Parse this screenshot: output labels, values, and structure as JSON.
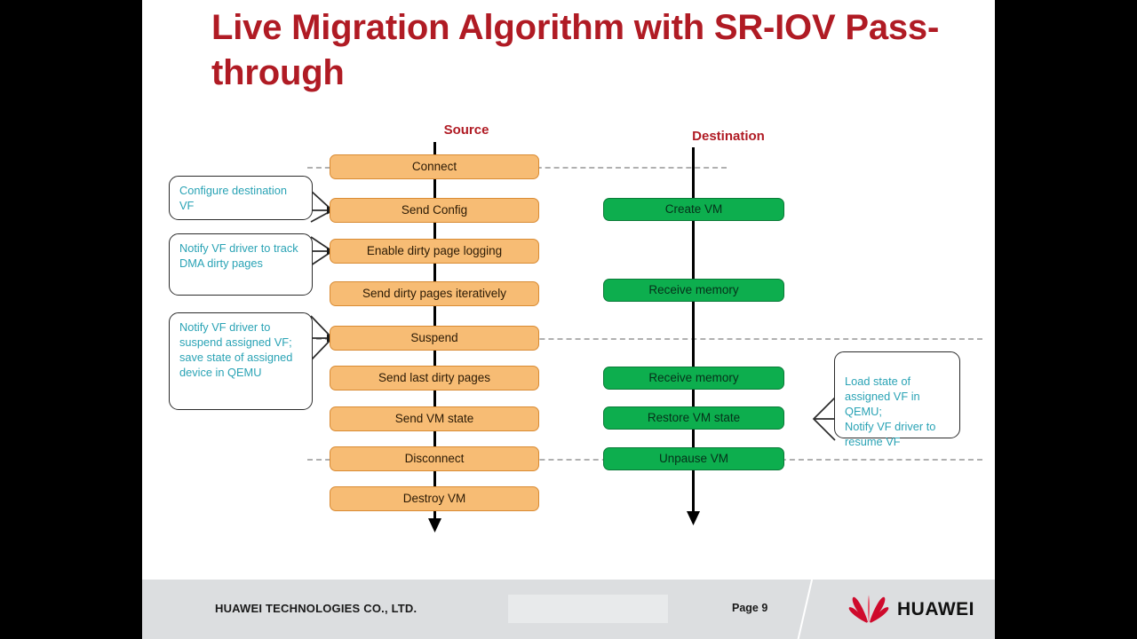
{
  "slide": {
    "title": "Live Migration Algorithm with SR-IOV Pass-through",
    "title_color": "#B01B24",
    "background": "#FFFFFF"
  },
  "columns": {
    "source_label": "Source",
    "destination_label": "Destination"
  },
  "colors": {
    "source_box_fill": "#F7BC74",
    "source_box_border": "#D98B33",
    "destination_box_fill": "#0DAE4E",
    "destination_box_border": "#0A7A38",
    "callout_text": "#2AA3B5",
    "dashed_line": "#B0B0B0",
    "flow_line": "#000000",
    "footer_bg": "#DCDEE0",
    "huawei_red": "#CF0A2C"
  },
  "source_steps": [
    {
      "label": "Connect"
    },
    {
      "label": "Send Config"
    },
    {
      "label": "Enable dirty page logging"
    },
    {
      "label": "Send dirty pages iteratively"
    },
    {
      "label": "Suspend"
    },
    {
      "label": "Send last dirty pages"
    },
    {
      "label": "Send VM state"
    },
    {
      "label": "Disconnect"
    },
    {
      "label": "Destroy VM"
    }
  ],
  "destination_steps": [
    {
      "label": "Create VM"
    },
    {
      "label": "Receive memory"
    },
    {
      "label": "Receive memory"
    },
    {
      "label": "Restore VM state"
    },
    {
      "label": "Unpause VM"
    }
  ],
  "callouts": [
    {
      "text": "Configure destination VF",
      "target": "Send Config"
    },
    {
      "text": "Notify VF driver to track DMA dirty pages",
      "target": "Enable dirty page logging"
    },
    {
      "text": "Notify VF driver to suspend assigned VF; save state of assigned device in QEMU",
      "target": "Suspend"
    },
    {
      "text": "Load state of assigned VF in QEMU;\nNotify VF driver to resume VF",
      "target": "Restore VM state"
    }
  ],
  "footer": {
    "company": "HUAWEI TECHNOLOGIES CO., LTD.",
    "page": "Page 9",
    "logo_text": "HUAWEI"
  }
}
